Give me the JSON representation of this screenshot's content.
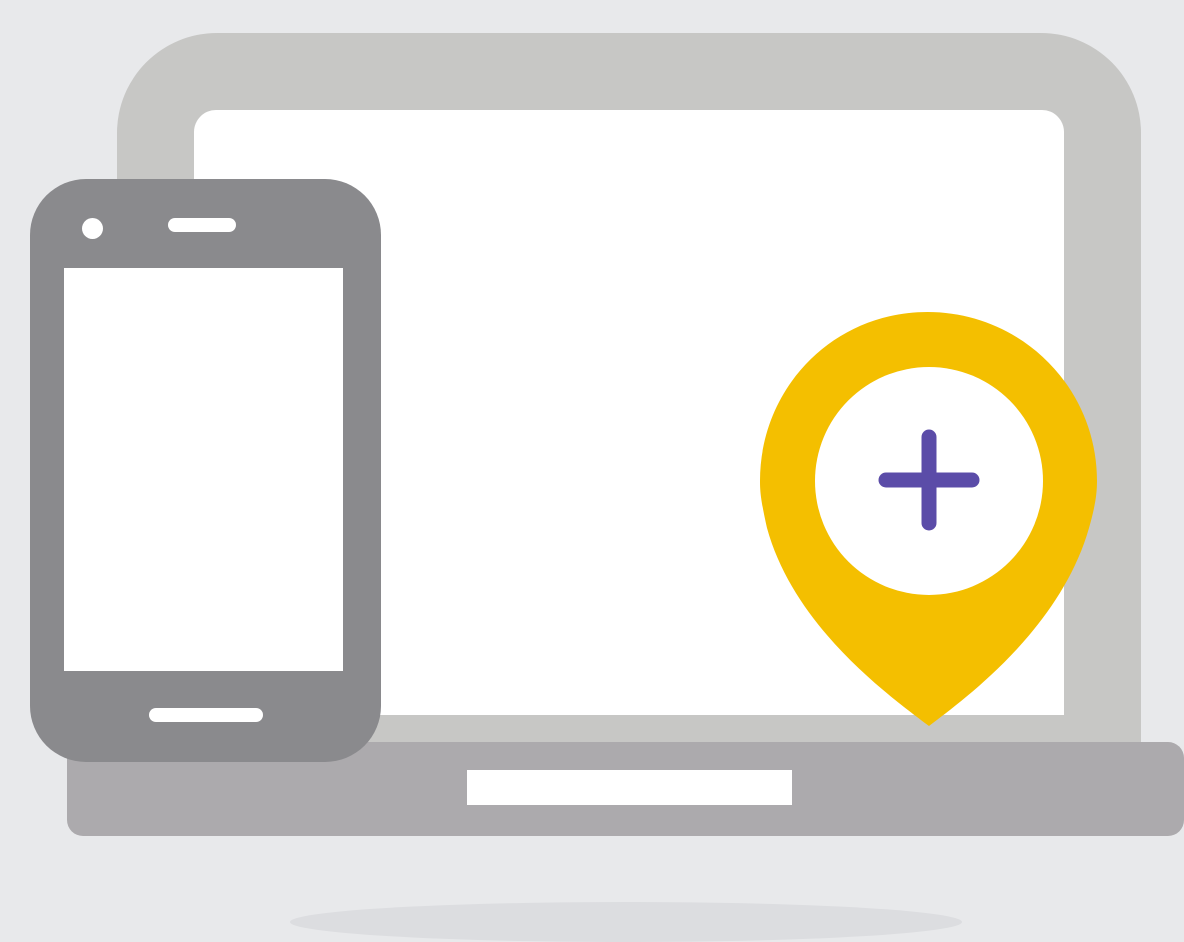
{
  "scene": {
    "background_color": "#e8e9eb",
    "devices": [
      "laptop",
      "smartphone"
    ],
    "icons": [
      "location-pin-icon",
      "plus-icon"
    ]
  },
  "colors": {
    "laptop_frame": "#c7c7c5",
    "laptop_base": "#acaaad",
    "phone_body": "#8a8a8d",
    "screen": "#ffffff",
    "pin_fill": "#f4bf00",
    "plus_stroke": "#5b4ca8"
  },
  "pin": {
    "icon": "location-pin-icon",
    "symbol": "plus-icon"
  }
}
